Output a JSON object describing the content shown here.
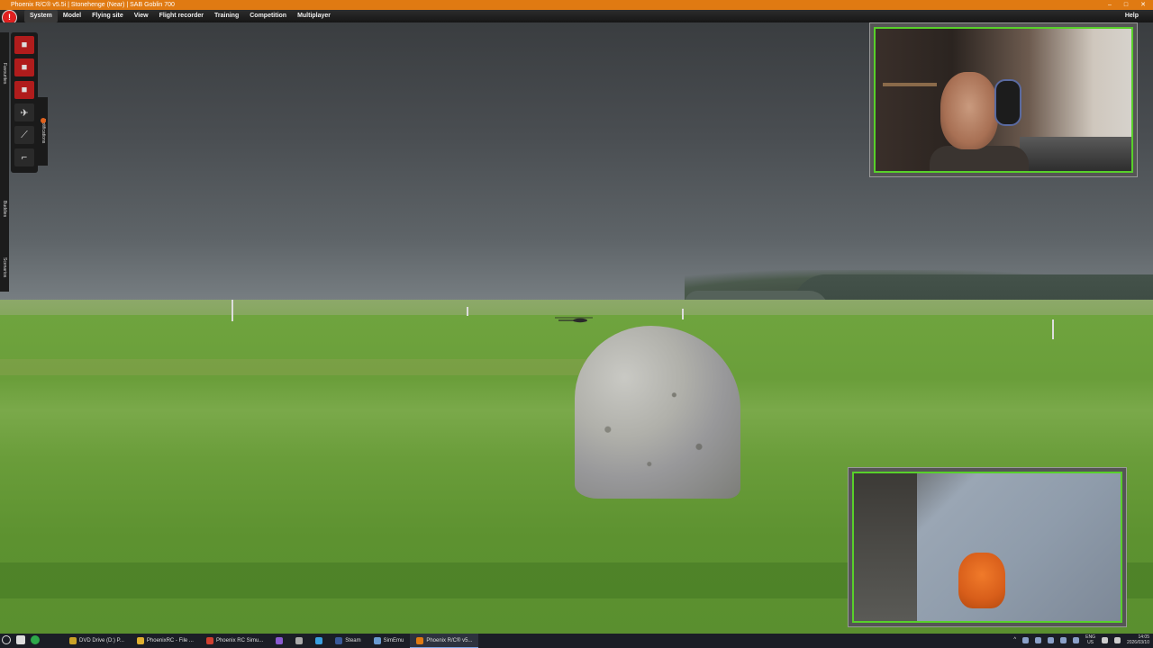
{
  "window": {
    "title": "Phoenix R/C® v5.5i  |  Stonehenge (Near)  |  SAB Goblin 700",
    "minimize_icon": "minimize-icon",
    "maximize_icon": "maximize-icon",
    "close_icon": "close-icon"
  },
  "menu": {
    "items": [
      "System",
      "Model",
      "Flying site",
      "View",
      "Flight recorder",
      "Training",
      "Competition",
      "Multiplayer"
    ],
    "active": "System",
    "help": "Help"
  },
  "side_tabs": {
    "favourites": "Favourites",
    "buddies": "Buddies",
    "scenarios": "Scenarios",
    "notifications": "Notifications"
  },
  "toolbar": {
    "tools": [
      {
        "icon": "record-icon",
        "color": "#b01c1c"
      },
      {
        "icon": "stop-icon",
        "color": "#b01c1c"
      },
      {
        "icon": "replay-icon",
        "color": "#b01c1c"
      },
      {
        "icon": "airplane-icon",
        "color": "#2a2a2a"
      },
      {
        "icon": "wrench-icon",
        "color": "#2a2a2a"
      },
      {
        "icon": "pistol-icon",
        "color": "#2a2a2a"
      }
    ]
  },
  "taskbar": {
    "items": [
      {
        "label": "DVD Drive (D:) P...",
        "icon": "disc-icon"
      },
      {
        "label": "PhoenixRC - File ...",
        "icon": "folder-icon"
      },
      {
        "label": "Phoenix RC Simu...",
        "icon": "browser-icon"
      },
      {
        "label": "",
        "icon": "visual-studio-icon"
      },
      {
        "label": "",
        "icon": "settings-icon"
      },
      {
        "label": "",
        "icon": "app-icon"
      },
      {
        "label": "Steam",
        "icon": "steam-icon"
      },
      {
        "label": "SimEmu",
        "icon": "simemu-icon"
      },
      {
        "label": "Phoenix R/C® v5...",
        "icon": "phoenix-icon",
        "active": true
      }
    ],
    "lang_top": "ENG",
    "lang_bottom": "US",
    "time": "14:05",
    "date": "2026/03/10"
  },
  "colors": {
    "titlebar": "#e07a12",
    "cam_border": "#58d02a",
    "accent_red": "#b01c1c"
  }
}
